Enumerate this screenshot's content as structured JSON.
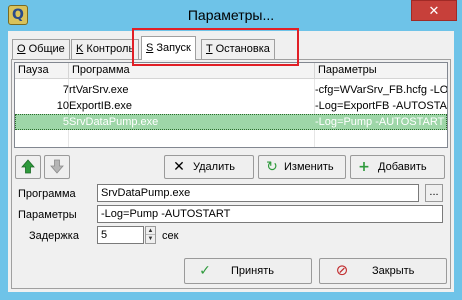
{
  "window": {
    "title": "Параметры...",
    "app_icon": "Q",
    "close_glyph": "✕"
  },
  "tabs": [
    {
      "key": "O",
      "label": "Общие",
      "active": false
    },
    {
      "key": "K",
      "label": "Контроль",
      "active": false
    },
    {
      "key": "S",
      "label": "Запуск",
      "active": true
    },
    {
      "key": "T",
      "label": "Остановка",
      "active": false
    }
  ],
  "grid": {
    "columns": {
      "pause": "Пауза",
      "program": "Программа",
      "params": "Параметры"
    },
    "rows": [
      {
        "pause": "7",
        "program": "rtVarSrv.exe",
        "params": "-cfg=WVarSrv_FB.hcfg -LO",
        "selected": false
      },
      {
        "pause": "10",
        "program": "ExportIB.exe",
        "params": "-Log=ExportFB -AUTOSTAR",
        "selected": false
      },
      {
        "pause": "5",
        "program": "SrvDataPump.exe",
        "params": "-Log=Pump -AUTOSTART",
        "selected": true
      }
    ]
  },
  "buttons": {
    "move_up_icon": "arrow-up-icon",
    "move_down_icon": "arrow-down-icon",
    "delete": "Удалить",
    "edit": "Изменить",
    "add": "Добавить",
    "apply": "Принять",
    "close": "Закрыть",
    "browse": "..."
  },
  "form": {
    "program_label": "Программа",
    "program_value": "SrvDataPump.exe",
    "params_label": "Параметры",
    "params_value": "-Log=Pump -AUTOSTART",
    "delay_label": "Задержка",
    "delay_value": "5",
    "delay_unit": "сек"
  },
  "colors": {
    "frame": "#6ec3e8",
    "close_button": "#c7403a",
    "selected_row": "#9ed6a8",
    "highlight_box": "#e11f26",
    "up_arrow": "#2e9a3c",
    "delete_icon": "#000000",
    "edit_icon": "#2e9a3c",
    "add_icon": "#2e9a3c",
    "apply_icon": "#2e9a3c",
    "close_icon": "#c0282a"
  }
}
